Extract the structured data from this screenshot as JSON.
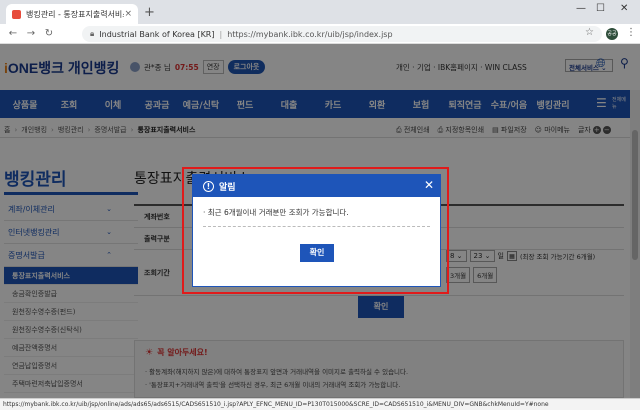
{
  "browser": {
    "tab_title": "뱅킹관리 - 통장표지출력서비스",
    "tab_close": "×",
    "new_tab": "+",
    "site_name": "Industrial Bank of Korea [KR]",
    "url": "https://mybank.ibk.co.kr/uib/jsp/index.jsp",
    "profile_initials": "공공",
    "window_controls": [
      "—",
      "☐",
      "✕"
    ]
  },
  "header": {
    "logo_text": "ONE뱅크 개인뱅킹",
    "logo_prefix": "i",
    "user_name": "관*종 님",
    "timer": "07:55",
    "extend_label": "연장",
    "logout_label": "로그아웃",
    "top_links": "개인 · 기업 · IBK홈페이지 · WIN CLASS",
    "service_select": "전체서비스 ⌄"
  },
  "gnb": {
    "items": [
      "상품몰",
      "조회",
      "이체",
      "공과금",
      "예금/신탁",
      "펀드",
      "대출",
      "카드",
      "외환",
      "보험",
      "퇴직연금",
      "수표/어음",
      "뱅킹관리"
    ],
    "menu_label": "전체메뉴"
  },
  "breadcrumb": {
    "items": [
      "홈",
      "개인뱅킹",
      "뱅킹관리",
      "증명서발급",
      "통장표지출력서비스"
    ],
    "actions": [
      "전체인쇄",
      "지정항목인쇄",
      "파일저장",
      "마이메뉴"
    ],
    "font_label": "글자"
  },
  "sidebar": {
    "title": "뱅킹관리",
    "items": [
      {
        "label": "계좌/이체관리",
        "chev": "⌄"
      },
      {
        "label": "인터넷뱅킹관리",
        "chev": "⌄"
      },
      {
        "label": "증명서발급",
        "chev": "⌃"
      }
    ],
    "subitems": [
      "통장표지출력서비스",
      "송금확인증발급",
      "원천징수영수증(펀드)",
      "원천징수영수증(신탁식)",
      "예금잔액증명서",
      "연금납입증명서",
      "주택마련저축납입증명서"
    ]
  },
  "main": {
    "page_title": "통장표지출력서비스",
    "rows": [
      "계좌번호",
      "출력구분",
      "조회기간"
    ],
    "period_day": "23",
    "period_month_select": "8 ⌄",
    "period_day_select": "23 ⌄",
    "period_day_suffix": "일",
    "period_note": "(최장 조회 가능기간 6개월)",
    "period_buttons": [
      "3개월",
      "6개월"
    ],
    "query_button": "확인"
  },
  "notice": {
    "title": "꼭 알아두세요!",
    "lines": [
      "· 활동계좌(해지하지 않은)에 대하여 통장표지 앞면과 거래내역을 이미지로 출력하실 수 있습니다.",
      "· '통장표지+거래내역 출력'을 선택하신 경우, 최근 6개월 이내의 거래내역 조회가 가능합니다."
    ]
  },
  "modal": {
    "title": "알림",
    "message": "· 최근 6개월이내 거래분만 조회가 가능합니다.",
    "ok_button": "확인",
    "close": "✕"
  },
  "status_bar": "https://mybank.ibk.co.kr/uib/jsp/online/ads/ads65/ads6515/CADS651510_i.jsp?APLY_EFNC_MENU_ID=P130T015000&SCRE_ID=CADS651510_i&MENU_DIV=GNB&chkMenuId=Y#none",
  "colors": {
    "brand_blue": "#1e55b9",
    "highlight_red": "#e01b1b"
  }
}
